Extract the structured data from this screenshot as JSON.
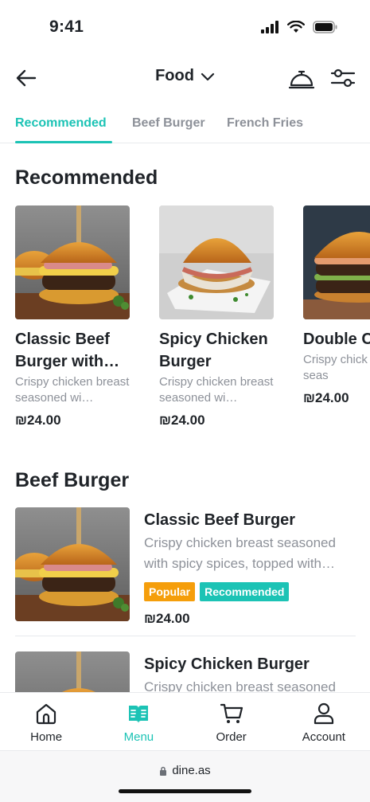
{
  "status_bar": {
    "time": "9:41"
  },
  "header": {
    "title": "Food"
  },
  "tabs": [
    {
      "label": "Recommended"
    },
    {
      "label": "Beef Burger"
    },
    {
      "label": "French Fries"
    }
  ],
  "recommended": {
    "title": "Recommended",
    "items": [
      {
        "name": "Classic Beef Burger with…",
        "description": "Crispy chicken breast seasoned wi…",
        "price": "₪24.00"
      },
      {
        "name": "Spicy Chicken Burger",
        "description": "Crispy chicken breast seasoned wi…",
        "price": "₪24.00"
      },
      {
        "name": "Double Cheeseb",
        "description": "Crispy chick breast seas",
        "price": "₪24.00"
      }
    ]
  },
  "beef_burger": {
    "title": "Beef Burger",
    "items": [
      {
        "name": "Classic Beef Burger",
        "description": "Crispy chicken breast seasoned with spicy spices, topped with…",
        "badges": [
          "Popular",
          "Recommended"
        ],
        "price": "₪24.00"
      },
      {
        "name": "Spicy Chicken Burger",
        "description": "Crispy chicken breast seasoned"
      }
    ]
  },
  "bottom_nav": [
    {
      "label": "Home",
      "icon": "home-icon"
    },
    {
      "label": "Menu",
      "icon": "menu-book-icon"
    },
    {
      "label": "Order",
      "icon": "cart-icon"
    },
    {
      "label": "Account",
      "icon": "user-icon"
    }
  ],
  "browser": {
    "url": "dine.as"
  },
  "colors": {
    "accent": "#1cc3b5",
    "popular": "#f59e0b",
    "text": "#1f2328",
    "muted": "#8d9199"
  }
}
